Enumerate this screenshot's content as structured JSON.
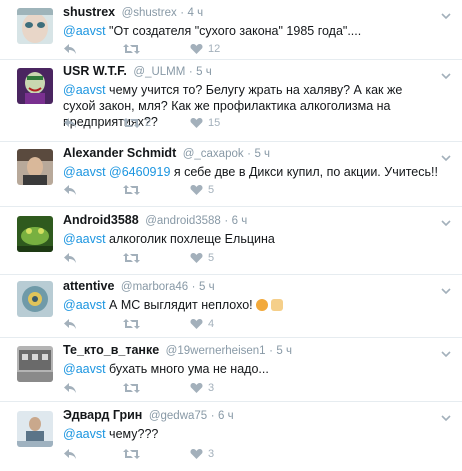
{
  "tweets": [
    {
      "name": "shustrex",
      "handle": "@shustrex",
      "dot": "·",
      "time": "4 ч",
      "mention": "@aavst",
      "text": " \"От создателя \"сухого закона\" 1985 года\"....",
      "retweets": "",
      "likes": "12",
      "avatar_bg": "#5b7e88"
    },
    {
      "name": "USR W.T.F.",
      "handle": "@_ULMM",
      "dot": "·",
      "time": "5 ч",
      "mention": "@aavst",
      "text": " чему учится то? Белугу жрать на халяву? А как же сухой закон, мля? Как же профилактика алкоголизма на предприятиях??",
      "retweets": "2",
      "likes": "15",
      "avatar_bg": "#5a2a6e"
    },
    {
      "name": "Alexander Schmidt",
      "handle": "@_caxapok",
      "dot": "·",
      "time": "5 ч",
      "mention": "@aavst @6460919",
      "text": " я себе две в Дикси купил, по акции. Учитесь!!",
      "retweets": "",
      "likes": "5",
      "avatar_bg": "#6b5a4e"
    },
    {
      "name": "Android3588",
      "handle": "@android3588",
      "dot": "·",
      "time": "6 ч",
      "mention": "@aavst",
      "text": " алкоголик похлеще Ельцина",
      "retweets": "",
      "likes": "5",
      "avatar_bg": "#3f7a2a"
    },
    {
      "name": "attentive",
      "handle": "@marbora46",
      "dot": "·",
      "time": "5 ч",
      "mention": "@aavst",
      "text": " А МС выглядит неплохо!",
      "retweets": "",
      "likes": "4",
      "avatar_bg": "#8fb4c4"
    },
    {
      "name": "Те_кто_в_танке",
      "handle": "@19wernerheisen1",
      "dot": "·",
      "time": "5 ч",
      "mention": "@aavst",
      "text": " бухать много ума не надо...",
      "retweets": "",
      "likes": "3",
      "avatar_bg": "#9a9a9a"
    },
    {
      "name": "Эдвард Грин",
      "handle": "@gedwa75",
      "dot": "·",
      "time": "6 ч",
      "mention": "@aavst",
      "text": " чему???",
      "retweets": "",
      "likes": "3",
      "avatar_bg": "#c8d6e0"
    }
  ],
  "colors": {
    "link": "#1b95e0",
    "muted": "#8899a6",
    "icon": "#a3b0bb",
    "border": "#e6ecf0"
  },
  "icons": {
    "reply": "reply-icon",
    "retweet": "retweet-icon",
    "like": "heart-icon",
    "more": "chevron-down-icon"
  }
}
